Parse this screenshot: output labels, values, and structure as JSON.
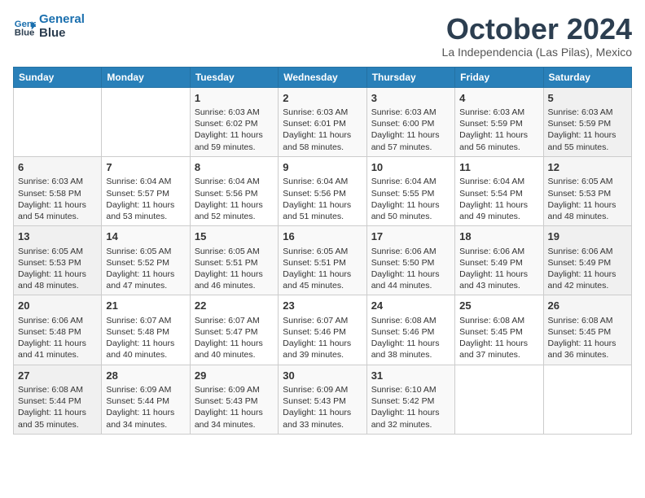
{
  "header": {
    "logo_line1": "General",
    "logo_line2": "Blue",
    "month": "October 2024",
    "location": "La Independencia (Las Pilas), Mexico"
  },
  "weekdays": [
    "Sunday",
    "Monday",
    "Tuesday",
    "Wednesday",
    "Thursday",
    "Friday",
    "Saturday"
  ],
  "weeks": [
    [
      {
        "day": "",
        "info": ""
      },
      {
        "day": "",
        "info": ""
      },
      {
        "day": "1",
        "info": "Sunrise: 6:03 AM\nSunset: 6:02 PM\nDaylight: 11 hours\nand 59 minutes."
      },
      {
        "day": "2",
        "info": "Sunrise: 6:03 AM\nSunset: 6:01 PM\nDaylight: 11 hours\nand 58 minutes."
      },
      {
        "day": "3",
        "info": "Sunrise: 6:03 AM\nSunset: 6:00 PM\nDaylight: 11 hours\nand 57 minutes."
      },
      {
        "day": "4",
        "info": "Sunrise: 6:03 AM\nSunset: 5:59 PM\nDaylight: 11 hours\nand 56 minutes."
      },
      {
        "day": "5",
        "info": "Sunrise: 6:03 AM\nSunset: 5:59 PM\nDaylight: 11 hours\nand 55 minutes."
      }
    ],
    [
      {
        "day": "6",
        "info": "Sunrise: 6:03 AM\nSunset: 5:58 PM\nDaylight: 11 hours\nand 54 minutes."
      },
      {
        "day": "7",
        "info": "Sunrise: 6:04 AM\nSunset: 5:57 PM\nDaylight: 11 hours\nand 53 minutes."
      },
      {
        "day": "8",
        "info": "Sunrise: 6:04 AM\nSunset: 5:56 PM\nDaylight: 11 hours\nand 52 minutes."
      },
      {
        "day": "9",
        "info": "Sunrise: 6:04 AM\nSunset: 5:56 PM\nDaylight: 11 hours\nand 51 minutes."
      },
      {
        "day": "10",
        "info": "Sunrise: 6:04 AM\nSunset: 5:55 PM\nDaylight: 11 hours\nand 50 minutes."
      },
      {
        "day": "11",
        "info": "Sunrise: 6:04 AM\nSunset: 5:54 PM\nDaylight: 11 hours\nand 49 minutes."
      },
      {
        "day": "12",
        "info": "Sunrise: 6:05 AM\nSunset: 5:53 PM\nDaylight: 11 hours\nand 48 minutes."
      }
    ],
    [
      {
        "day": "13",
        "info": "Sunrise: 6:05 AM\nSunset: 5:53 PM\nDaylight: 11 hours\nand 48 minutes."
      },
      {
        "day": "14",
        "info": "Sunrise: 6:05 AM\nSunset: 5:52 PM\nDaylight: 11 hours\nand 47 minutes."
      },
      {
        "day": "15",
        "info": "Sunrise: 6:05 AM\nSunset: 5:51 PM\nDaylight: 11 hours\nand 46 minutes."
      },
      {
        "day": "16",
        "info": "Sunrise: 6:05 AM\nSunset: 5:51 PM\nDaylight: 11 hours\nand 45 minutes."
      },
      {
        "day": "17",
        "info": "Sunrise: 6:06 AM\nSunset: 5:50 PM\nDaylight: 11 hours\nand 44 minutes."
      },
      {
        "day": "18",
        "info": "Sunrise: 6:06 AM\nSunset: 5:49 PM\nDaylight: 11 hours\nand 43 minutes."
      },
      {
        "day": "19",
        "info": "Sunrise: 6:06 AM\nSunset: 5:49 PM\nDaylight: 11 hours\nand 42 minutes."
      }
    ],
    [
      {
        "day": "20",
        "info": "Sunrise: 6:06 AM\nSunset: 5:48 PM\nDaylight: 11 hours\nand 41 minutes."
      },
      {
        "day": "21",
        "info": "Sunrise: 6:07 AM\nSunset: 5:48 PM\nDaylight: 11 hours\nand 40 minutes."
      },
      {
        "day": "22",
        "info": "Sunrise: 6:07 AM\nSunset: 5:47 PM\nDaylight: 11 hours\nand 40 minutes."
      },
      {
        "day": "23",
        "info": "Sunrise: 6:07 AM\nSunset: 5:46 PM\nDaylight: 11 hours\nand 39 minutes."
      },
      {
        "day": "24",
        "info": "Sunrise: 6:08 AM\nSunset: 5:46 PM\nDaylight: 11 hours\nand 38 minutes."
      },
      {
        "day": "25",
        "info": "Sunrise: 6:08 AM\nSunset: 5:45 PM\nDaylight: 11 hours\nand 37 minutes."
      },
      {
        "day": "26",
        "info": "Sunrise: 6:08 AM\nSunset: 5:45 PM\nDaylight: 11 hours\nand 36 minutes."
      }
    ],
    [
      {
        "day": "27",
        "info": "Sunrise: 6:08 AM\nSunset: 5:44 PM\nDaylight: 11 hours\nand 35 minutes."
      },
      {
        "day": "28",
        "info": "Sunrise: 6:09 AM\nSunset: 5:44 PM\nDaylight: 11 hours\nand 34 minutes."
      },
      {
        "day": "29",
        "info": "Sunrise: 6:09 AM\nSunset: 5:43 PM\nDaylight: 11 hours\nand 34 minutes."
      },
      {
        "day": "30",
        "info": "Sunrise: 6:09 AM\nSunset: 5:43 PM\nDaylight: 11 hours\nand 33 minutes."
      },
      {
        "day": "31",
        "info": "Sunrise: 6:10 AM\nSunset: 5:42 PM\nDaylight: 11 hours\nand 32 minutes."
      },
      {
        "day": "",
        "info": ""
      },
      {
        "day": "",
        "info": ""
      }
    ]
  ]
}
